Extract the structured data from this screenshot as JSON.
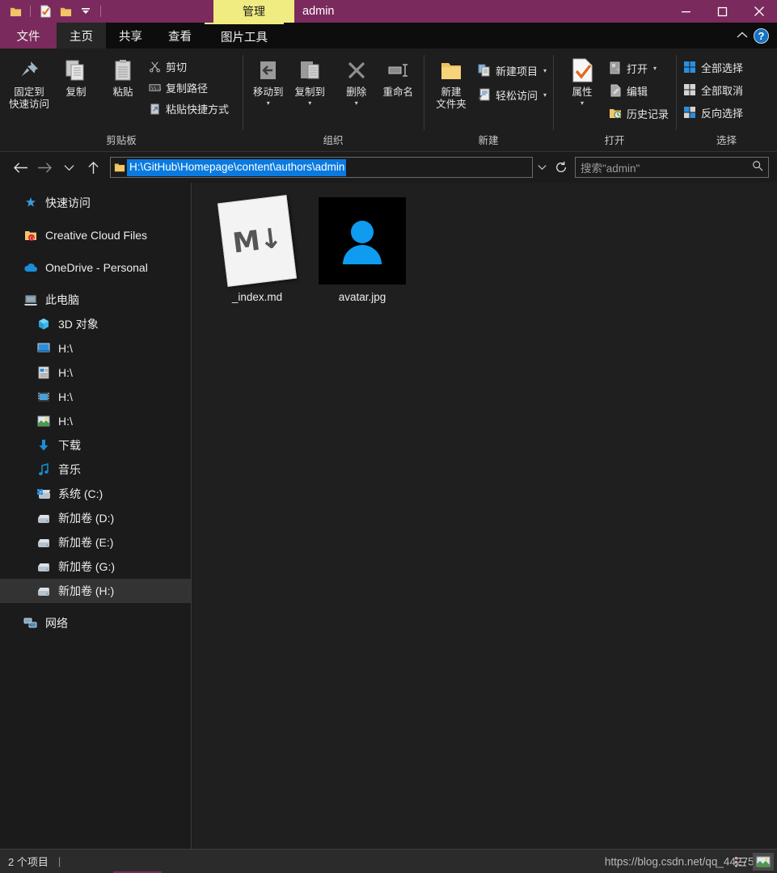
{
  "titlebar": {
    "quick_access": [
      {
        "name": "folder-icon",
        "label": "文件夹"
      },
      {
        "name": "properties-icon",
        "label": "属性"
      },
      {
        "name": "new-folder-icon",
        "label": "新建文件夹"
      },
      {
        "name": "customize-dropdown-icon",
        "label": "自定义快速访问工具栏"
      }
    ],
    "contextual_tab_label": "管理",
    "window_title": "admin",
    "controls": {
      "minimize": "最小化",
      "maximize": "最大化",
      "close": "关闭"
    }
  },
  "tabs": [
    {
      "label": "文件",
      "name": "tab-file",
      "style": "file"
    },
    {
      "label": "主页",
      "name": "tab-home",
      "style": "active"
    },
    {
      "label": "共享",
      "name": "tab-share",
      "style": "normal"
    },
    {
      "label": "查看",
      "name": "tab-view",
      "style": "normal"
    },
    {
      "label": "图片工具",
      "name": "tab-picture-tools",
      "style": "ctxtool"
    }
  ],
  "tabstrip_right": {
    "collapse_label": "折叠功能区",
    "help_label": "?"
  },
  "ribbon": {
    "groups": [
      {
        "name": "clipboard",
        "label": "剪贴板",
        "big_buttons": [
          {
            "name": "pin-to-quick-access-button",
            "label": "固定到\n快速访问",
            "line1": "固定到",
            "line2": "快速访问",
            "icon": "pin-icon"
          },
          {
            "name": "copy-button",
            "label": "复制",
            "icon": "copy-icon"
          },
          {
            "name": "paste-button",
            "label": "粘贴",
            "icon": "paste-icon"
          }
        ],
        "small_buttons": [
          {
            "name": "cut-button",
            "label": "剪切",
            "icon": "scissors-icon"
          },
          {
            "name": "copy-path-button",
            "label": "复制路径",
            "icon": "copy-path-icon"
          },
          {
            "name": "paste-shortcut-button",
            "label": "粘贴快捷方式",
            "icon": "paste-shortcut-icon"
          }
        ]
      },
      {
        "name": "organize",
        "label": "组织",
        "big_buttons": [
          {
            "name": "move-to-button",
            "label": "移动到",
            "icon": "move-to-icon",
            "has_caret": true
          },
          {
            "name": "copy-to-button",
            "label": "复制到",
            "icon": "copy-to-icon",
            "has_caret": true
          },
          {
            "name": "delete-button",
            "label": "删除",
            "icon": "delete-icon",
            "has_caret": true
          },
          {
            "name": "rename-button",
            "label": "重命名",
            "icon": "rename-icon"
          }
        ],
        "small_buttons": []
      },
      {
        "name": "new",
        "label": "新建",
        "big_buttons": [
          {
            "name": "new-folder-button",
            "label": "新建\n文件夹",
            "line1": "新建",
            "line2": "文件夹",
            "icon": "new-folder-icon"
          }
        ],
        "small_buttons": [
          {
            "name": "new-item-button",
            "label": "新建项目",
            "icon": "new-item-icon",
            "has_caret": true
          },
          {
            "name": "easy-access-button",
            "label": "轻松访问",
            "icon": "easy-access-icon",
            "has_caret": true
          }
        ]
      },
      {
        "name": "open",
        "label": "打开",
        "big_buttons": [
          {
            "name": "properties-button",
            "label": "属性",
            "icon": "properties-icon",
            "has_caret": true
          }
        ],
        "small_buttons": [
          {
            "name": "open-button",
            "label": "打开",
            "icon": "open-icon",
            "has_caret": true
          },
          {
            "name": "edit-button",
            "label": "编辑",
            "icon": "edit-icon"
          },
          {
            "name": "history-button",
            "label": "历史记录",
            "icon": "history-icon"
          }
        ]
      },
      {
        "name": "select",
        "label": "选择",
        "big_buttons": [],
        "small_buttons": [
          {
            "name": "select-all-button",
            "label": "全部选择",
            "icon": "select-all-icon"
          },
          {
            "name": "select-none-button",
            "label": "全部取消",
            "icon": "select-none-icon"
          },
          {
            "name": "invert-selection-button",
            "label": "反向选择",
            "icon": "invert-selection-icon"
          }
        ]
      }
    ]
  },
  "addressbar": {
    "back_label": "后退",
    "forward_label": "前进",
    "recent_label": "最近浏览的位置",
    "up_label": "上移到",
    "path": "H:\\GitHub\\Homepage\\content\\authors\\admin",
    "dropdown_label": "上一个位置",
    "refresh_label": "刷新",
    "search_placeholder": "搜索\"admin\""
  },
  "sidebar": {
    "items": [
      {
        "label": "快速访问",
        "name": "sidebar-item-quick-access",
        "icon": "star-pin-icon",
        "level": 0,
        "selected": false
      },
      {
        "label": "Creative Cloud Files",
        "name": "sidebar-item-creative-cloud-files",
        "icon": "creative-cloud-folder-icon",
        "level": 0,
        "selected": false
      },
      {
        "label": "OneDrive - Personal",
        "name": "sidebar-item-onedrive-personal",
        "icon": "onedrive-cloud-icon",
        "level": 0,
        "selected": false
      },
      {
        "label": "此电脑",
        "name": "sidebar-item-this-pc",
        "icon": "this-pc-icon",
        "level": 0,
        "selected": false
      },
      {
        "label": "3D 对象",
        "name": "sidebar-item-3d-objects",
        "icon": "3d-objects-icon",
        "level": 1,
        "selected": false
      },
      {
        "label": "H:\\",
        "name": "sidebar-item-desktop",
        "icon": "desktop-icon",
        "level": 1,
        "selected": false
      },
      {
        "label": "H:\\",
        "name": "sidebar-item-documents",
        "icon": "documents-icon",
        "level": 1,
        "selected": false
      },
      {
        "label": "H:\\",
        "name": "sidebar-item-videos",
        "icon": "videos-icon",
        "level": 1,
        "selected": false
      },
      {
        "label": "H:\\",
        "name": "sidebar-item-pictures",
        "icon": "pictures-icon",
        "level": 1,
        "selected": false
      },
      {
        "label": "下载",
        "name": "sidebar-item-downloads",
        "icon": "download-arrow-icon",
        "level": 1,
        "selected": false
      },
      {
        "label": "音乐",
        "name": "sidebar-item-music",
        "icon": "music-note-icon",
        "level": 1,
        "selected": false
      },
      {
        "label": "系统 (C:)",
        "name": "sidebar-item-drive-c",
        "icon": "windows-drive-icon",
        "level": 1,
        "selected": false
      },
      {
        "label": "新加卷 (D:)",
        "name": "sidebar-item-drive-d",
        "icon": "drive-icon",
        "level": 1,
        "selected": false
      },
      {
        "label": "新加卷 (E:)",
        "name": "sidebar-item-drive-e",
        "icon": "drive-icon",
        "level": 1,
        "selected": false
      },
      {
        "label": "新加卷 (G:)",
        "name": "sidebar-item-drive-g",
        "icon": "drive-icon",
        "level": 1,
        "selected": false
      },
      {
        "label": "新加卷 (H:)",
        "name": "sidebar-item-drive-h",
        "icon": "drive-icon",
        "level": 1,
        "selected": true
      },
      {
        "label": "网络",
        "name": "sidebar-item-network",
        "icon": "network-icon",
        "level": 0,
        "selected": false
      }
    ]
  },
  "content": {
    "files": [
      {
        "name": "_index.md",
        "type": "markdown",
        "icon": "markdown-file-icon",
        "glyph": "M↓"
      },
      {
        "name": "avatar.jpg",
        "type": "image",
        "icon": "avatar-image-icon"
      }
    ]
  },
  "statusbar": {
    "item_count_text": "2 个项目",
    "watermark": "https://blog.csdn.net/qq_44275286",
    "view_buttons": [
      {
        "name": "details-view-button",
        "label": "详细信息",
        "active": false
      },
      {
        "name": "large-icons-view-button",
        "label": "大图标",
        "active": true
      }
    ]
  },
  "colors": {
    "titlebar": "#7a2a5c",
    "contextual_tab": "#f0ec81",
    "selection_blue": "#0a7ae0",
    "accent_avatar": "#0f9bf0"
  }
}
